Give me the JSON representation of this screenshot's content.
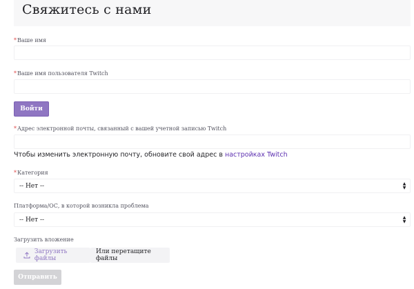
{
  "page": {
    "title": "Свяжитесь с нами"
  },
  "form": {
    "required_mark": "*",
    "name_label": "Ваше имя",
    "name_value": "",
    "twitch_user_label": "Ваше имя пользователя Twitch",
    "twitch_user_value": "",
    "login_button": "Войти",
    "email_label": "Адрес электронной почты, связанный с вашей учетной записью Twitch",
    "email_value": "",
    "email_note": "Чтобы изменить электронную почту, обновите свой адрес в ",
    "email_note_link": "настройках Twitch",
    "category_label": "Категория",
    "category_value": "-- Нет --",
    "platform_label": "Платформа/ОС, в которой возникла проблема",
    "platform_value": "-- Нет --",
    "attachment_label": "Загрузить вложение",
    "upload_button": "Загрузить файлы",
    "drop_text": "Или перетащите файлы",
    "submit_button": "Отправить"
  },
  "icons": {
    "select_arrows": "select-arrows-icon",
    "upload": "upload-icon"
  },
  "colors": {
    "accent": "#8f76c2",
    "link": "#5c2fb0",
    "disabled": "#d3d3d6"
  }
}
